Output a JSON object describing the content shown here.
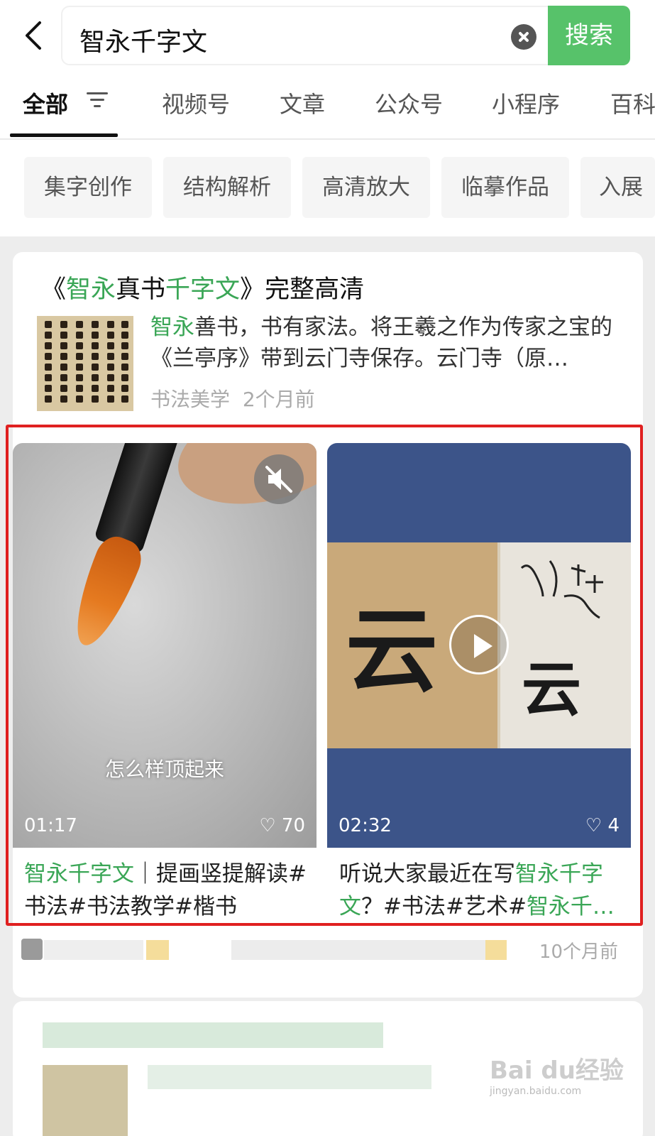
{
  "search": {
    "query": "智永千字文",
    "button": "搜索"
  },
  "tabs": [
    {
      "label": "全部"
    },
    {
      "label": "视频号"
    },
    {
      "label": "文章"
    },
    {
      "label": "公众号"
    },
    {
      "label": "小程序"
    },
    {
      "label": "百科"
    }
  ],
  "chips": [
    "集字创作",
    "结构解析",
    "高清放大",
    "临摹作品",
    "入展"
  ],
  "article": {
    "title_parts": [
      "《",
      "智永",
      "真书",
      "千字文",
      "》完整高清"
    ],
    "body_hl": "智永",
    "body": "善书，书有家法。将王羲之作为传家之宝的《兰亭序》带到云门寺保存。云门寺（原…",
    "source": "书法美学",
    "time": "2个月前"
  },
  "videos": [
    {
      "caption": "怎么样顶起来",
      "duration": "01:17",
      "likes": "70",
      "title_hl": "智永千字文",
      "title_rest": "｜提画竖提解读#书法#书法教学#楷书"
    },
    {
      "char_left": "云",
      "char_right": "云",
      "duration": "02:32",
      "likes": "4",
      "title_pre": "听说大家最近在写",
      "title_hl": "智永千字文",
      "title_mid": "？#书法#艺术#",
      "title_hl2": "智永千…"
    }
  ],
  "footer_time": "10个月前",
  "watermark": {
    "brand": "Bai du经验",
    "url": "jingyan.baidu.com"
  },
  "colors": {
    "accent": "#57c26a",
    "highlight_text": "#3aa656",
    "frame": "#e02020"
  }
}
